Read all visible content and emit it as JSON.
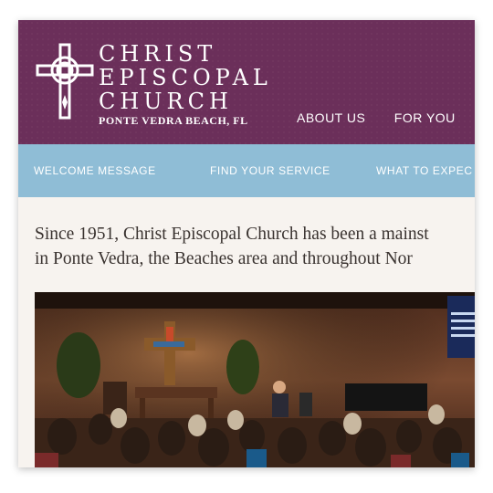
{
  "header": {
    "logo_lines": [
      "CHRIST",
      "EPISCOPAL",
      "CHURCH"
    ],
    "location": "PONTE VEDRA BEACH, FL",
    "nav": [
      "ABOUT US",
      "FOR YOU"
    ]
  },
  "subnav": [
    "WELCOME MESSAGE",
    "FIND YOUR SERVICE",
    "WHAT TO EXPEC"
  ],
  "intro": {
    "line1": "Since 1951, Christ Episcopal Church has been a mainst",
    "line2": "in Ponte Vedra, the Beaches area and throughout Nor"
  },
  "colors": {
    "header_bg": "#6b2f5a",
    "subnav_bg": "#8fbdd6",
    "page_bg": "#f7f3ef",
    "text": "#3a3330"
  },
  "icons": {
    "logo": "celtic-cross-icon"
  }
}
